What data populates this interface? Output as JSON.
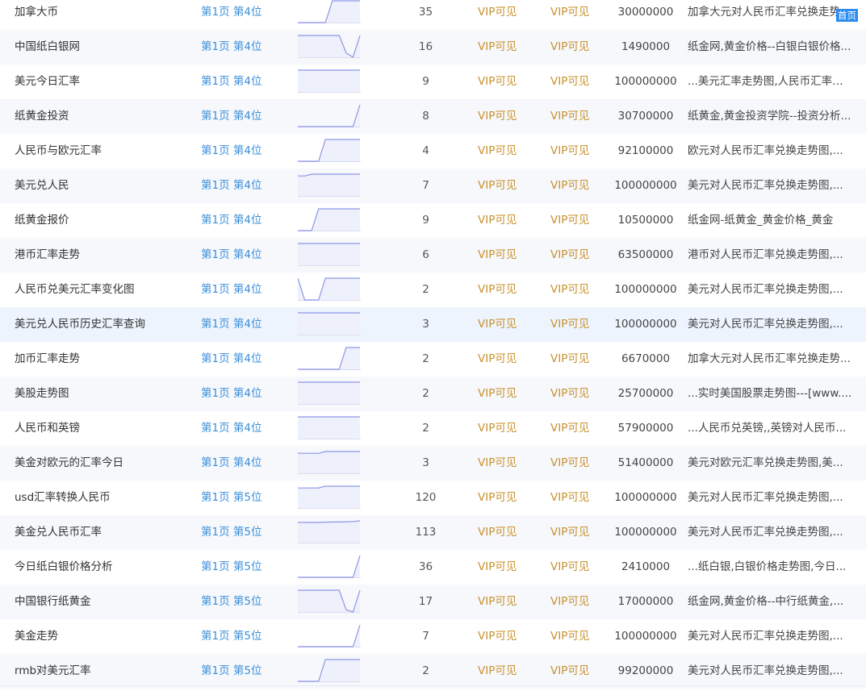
{
  "colors": {
    "rank_link": "#3b8fd9",
    "vip_text": "#c8912e",
    "trend_line": "#8d96e6",
    "trend_fill": "#eef0fc",
    "badge_bg": "#2d8cf0"
  },
  "rows": [
    {
      "keyword": "加拿大币",
      "rank": "第1页 第4位",
      "index": "35",
      "vip1": "VIP可见",
      "vip2": "VIP可见",
      "results": "30000000",
      "title": "加拿大元对人民币汇率兑换走势...",
      "trend": [
        0,
        0,
        0,
        0,
        0,
        1,
        1,
        1,
        1,
        1
      ]
    },
    {
      "keyword": "中国纸白银网",
      "rank": "第1页 第4位",
      "index": "16",
      "vip1": "VIP可见",
      "vip2": "VIP可见",
      "results": "1490000",
      "title": "纸金网,黄金价格--白银白银价格...",
      "trend": [
        1,
        1,
        1,
        1,
        1,
        1,
        1,
        0.2,
        0,
        1
      ]
    },
    {
      "keyword": "美元今日汇率",
      "rank": "第1页 第4位",
      "index": "9",
      "vip1": "VIP可见",
      "vip2": "VIP可见",
      "results": "100000000",
      "title": "...美元汇率走势图,人民币汇率走...",
      "trend": [
        1,
        1,
        1,
        1,
        1,
        1,
        1,
        1,
        1,
        1
      ]
    },
    {
      "keyword": "纸黄金投资",
      "rank": "第1页 第4位",
      "index": "8",
      "vip1": "VIP可见",
      "vip2": "VIP可见",
      "results": "30700000",
      "title": "纸黄金,黄金投资学院--投资分析...",
      "trend": [
        0,
        0,
        0,
        0,
        0,
        0,
        0,
        0,
        0,
        1
      ]
    },
    {
      "keyword": "人民币与欧元汇率",
      "rank": "第1页 第4位",
      "index": "4",
      "vip1": "VIP可见",
      "vip2": "VIP可见",
      "results": "92100000",
      "title": "欧元对人民币汇率兑换走势图,...",
      "trend": [
        0,
        0,
        0,
        0,
        1,
        1,
        1,
        1,
        1,
        1
      ]
    },
    {
      "keyword": "美元兑人民",
      "rank": "第1页 第4位",
      "index": "7",
      "vip1": "VIP可见",
      "vip2": "VIP可见",
      "results": "100000000",
      "title": "美元对人民币汇率兑换走势图,...",
      "trend": [
        0.92,
        0.92,
        1,
        1,
        1,
        1,
        1,
        1,
        1,
        1
      ]
    },
    {
      "keyword": "纸黄金报价",
      "rank": "第1页 第4位",
      "index": "9",
      "vip1": "VIP可见",
      "vip2": "VIP可见",
      "results": "10500000",
      "title": "纸金网-纸黄金_黄金价格_黄金",
      "trend": [
        0,
        0,
        0,
        1,
        1,
        1,
        1,
        1,
        1,
        1
      ]
    },
    {
      "keyword": "港币汇率走势",
      "rank": "第1页 第4位",
      "index": "6",
      "vip1": "VIP可见",
      "vip2": "VIP可见",
      "results": "63500000",
      "title": "港币对人民币汇率兑换走势图,...",
      "trend": [
        1,
        1,
        1,
        1,
        1,
        1,
        1,
        1,
        1,
        1
      ]
    },
    {
      "keyword": "人民币兑美元汇率变化图",
      "rank": "第1页 第4位",
      "index": "2",
      "vip1": "VIP可见",
      "vip2": "VIP可见",
      "results": "100000000",
      "title": "美元对人民币汇率兑换走势图,...",
      "trend": [
        1,
        0,
        0,
        0,
        1,
        1,
        1,
        1,
        1,
        1
      ]
    },
    {
      "keyword": "美元兑人民币历史汇率查询",
      "rank": "第1页 第4位",
      "index": "3",
      "vip1": "VIP可见",
      "vip2": "VIP可见",
      "results": "100000000",
      "title": "美元对人民币汇率兑换走势图,...",
      "trend": [
        1,
        1,
        1,
        1,
        1,
        1,
        1,
        1,
        1,
        1
      ]
    },
    {
      "keyword": "加币汇率走势",
      "rank": "第1页 第4位",
      "index": "2",
      "vip1": "VIP可见",
      "vip2": "VIP可见",
      "results": "6670000",
      "title": "加拿大元对人民币汇率兑换走势...",
      "trend": [
        0,
        0,
        0,
        0,
        0,
        0,
        0,
        1,
        1,
        1
      ]
    },
    {
      "keyword": "美股走势图",
      "rank": "第1页 第4位",
      "index": "2",
      "vip1": "VIP可见",
      "vip2": "VIP可见",
      "results": "25700000",
      "title": "...实时美国股票走势图---[www....",
      "trend": [
        1,
        1,
        1,
        1,
        1,
        1,
        1,
        1,
        1,
        1
      ]
    },
    {
      "keyword": "人民币和英镑",
      "rank": "第1页 第4位",
      "index": "2",
      "vip1": "VIP可见",
      "vip2": "VIP可见",
      "results": "57900000",
      "title": "...人民币兑英镑,,英镑对人民币...",
      "trend": [
        1,
        1,
        1,
        1,
        1,
        1,
        1,
        1,
        1,
        1
      ]
    },
    {
      "keyword": "美金对欧元的汇率今日",
      "rank": "第1页 第4位",
      "index": "3",
      "vip1": "VIP可见",
      "vip2": "VIP可见",
      "results": "51400000",
      "title": "美元对欧元汇率兑换走势图,美...",
      "trend": [
        0.92,
        0.92,
        0.92,
        0.92,
        1,
        1,
        1,
        1,
        1,
        1
      ]
    },
    {
      "keyword": "usd汇率转换人民币",
      "rank": "第1页 第5位",
      "index": "120",
      "vip1": "VIP可见",
      "vip2": "VIP可见",
      "results": "100000000",
      "title": "美元对人民币汇率兑换走势图,...",
      "trend": [
        0.92,
        0.92,
        0.92,
        0.92,
        1,
        1,
        1,
        1,
        1,
        1
      ]
    },
    {
      "keyword": "美金兑人民币汇率",
      "rank": "第1页 第5位",
      "index": "113",
      "vip1": "VIP可见",
      "vip2": "VIP可见",
      "results": "100000000",
      "title": "美元对人民币汇率兑换走势图,...",
      "trend": [
        0.93,
        0.93,
        0.93,
        0.93,
        0.94,
        0.95,
        0.95,
        0.96,
        0.97,
        1
      ]
    },
    {
      "keyword": "今日纸白银价格分析",
      "rank": "第1页 第5位",
      "index": "36",
      "vip1": "VIP可见",
      "vip2": "VIP可见",
      "results": "2410000",
      "title": "...纸白银,白银价格走势图,今日...",
      "trend": [
        0,
        0,
        0,
        0,
        0,
        0,
        0,
        0,
        0,
        1
      ]
    },
    {
      "keyword": "中国银行纸黄金",
      "rank": "第1页 第5位",
      "index": "17",
      "vip1": "VIP可见",
      "vip2": "VIP可见",
      "results": "17000000",
      "title": "纸金网,黄金价格--中行纸黄金,...",
      "trend": [
        1,
        1,
        1,
        1,
        1,
        1,
        1,
        0.1,
        0,
        1
      ]
    },
    {
      "keyword": "美金走势",
      "rank": "第1页 第5位",
      "index": "7",
      "vip1": "VIP可见",
      "vip2": "VIP可见",
      "results": "100000000",
      "title": "美元对人民币汇率兑换走势图,...",
      "trend": [
        0,
        0,
        0,
        0,
        0,
        0,
        0,
        0,
        0,
        1
      ]
    },
    {
      "keyword": "rmb对美元汇率",
      "rank": "第1页 第5位",
      "index": "2",
      "vip1": "VIP可见",
      "vip2": "VIP可见",
      "results": "99200000",
      "title": "美元对人民币汇率兑换走势图,...",
      "trend": [
        0,
        0,
        0,
        0,
        1,
        1,
        1,
        1,
        1,
        1
      ]
    }
  ],
  "badge": {
    "label": "首页"
  }
}
